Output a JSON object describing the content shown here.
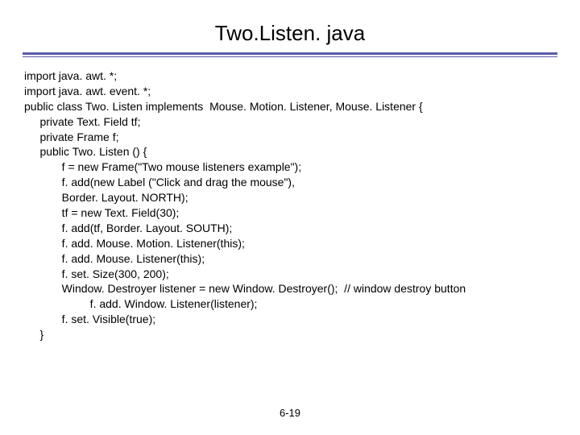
{
  "title": "Two.Listen. java",
  "code_lines": [
    "import java. awt. *;",
    "import java. awt. event. *;",
    "public class Two. Listen implements  Mouse. Motion. Listener, Mouse. Listener {",
    "     private Text. Field tf;",
    "     private Frame f;",
    "     public Two. Listen () {",
    "            f = new Frame(\"Two mouse listeners example\");",
    "            f. add(new Label (\"Click and drag the mouse\"),",
    "            Border. Layout. NORTH);",
    "            tf = new Text. Field(30);",
    "            f. add(tf, Border. Layout. SOUTH);",
    "            f. add. Mouse. Motion. Listener(this);",
    "            f. add. Mouse. Listener(this);",
    "            f. set. Size(300, 200);",
    "            Window. Destroyer listener = new Window. Destroyer();  // window destroy button",
    "                     f. add. Window. Listener(listener);",
    "            f. set. Visible(true);",
    "     }"
  ],
  "page_number": "6-19"
}
